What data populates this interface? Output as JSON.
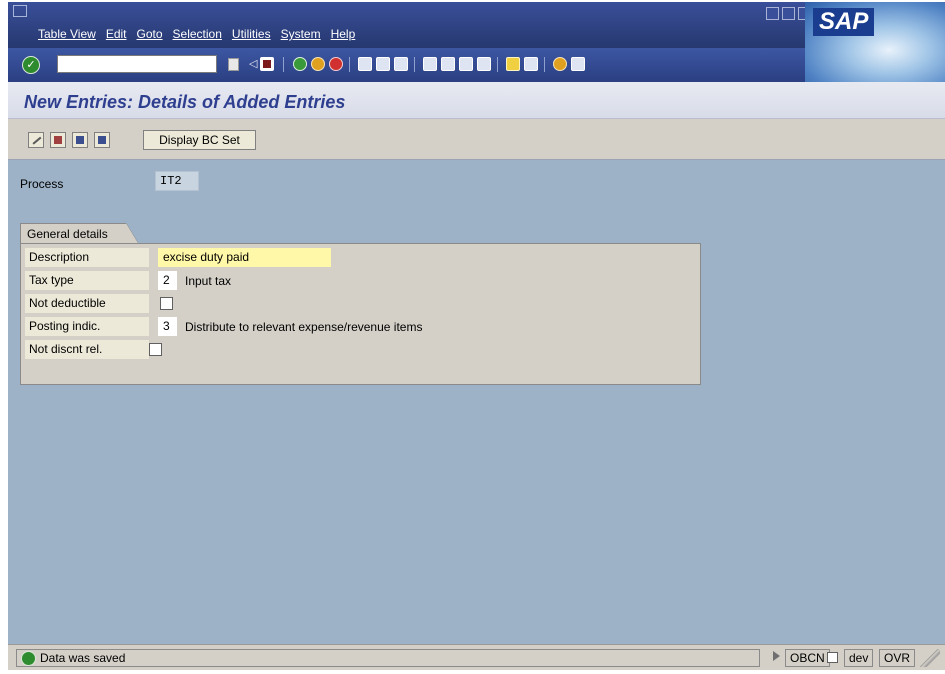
{
  "menu": [
    "Table View",
    "Edit",
    "Goto",
    "Selection",
    "Utilities",
    "System",
    "Help"
  ],
  "logo": "SAP",
  "command_field": {
    "value": ""
  },
  "title": "New Entries: Details of Added Entries",
  "app_toolbar": {
    "bc_set_label": "Display BC Set"
  },
  "process": {
    "label": "Process",
    "value": "IT2"
  },
  "group": {
    "title": "General details",
    "fields": {
      "description": {
        "label": "Description",
        "value": "excise duty paid"
      },
      "tax_type": {
        "label": "Tax type",
        "value": "2",
        "text": "Input tax"
      },
      "not_deductible": {
        "label": "Not deductible",
        "checked": false
      },
      "posting_indic": {
        "label": "Posting indic.",
        "value": "3",
        "text": "Distribute to relevant expense/revenue items"
      },
      "not_discnt_rel": {
        "label": "Not discnt rel.",
        "checked": false
      }
    }
  },
  "status": {
    "message": "Data was saved",
    "system": "OBCN",
    "client": "dev",
    "mode": "OVR"
  },
  "colors": {
    "menubar": "#2f4486",
    "title_text": "#2f3f8f",
    "content_bg": "#9db2c6",
    "required_field": "#fff8a8"
  }
}
